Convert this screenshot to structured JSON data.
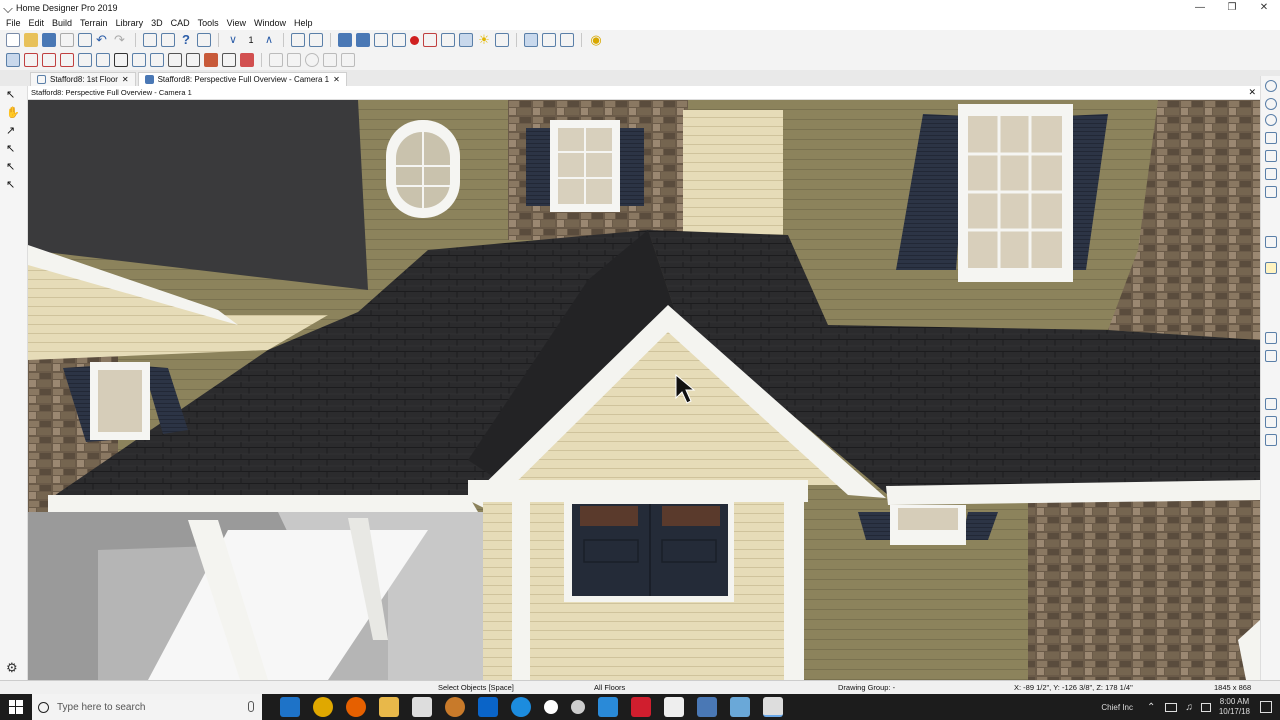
{
  "window": {
    "title": "Home Designer Pro 2019",
    "controls": {
      "minimize": "—",
      "restore": "❐",
      "close": "✕"
    }
  },
  "menu": [
    "File",
    "Edit",
    "Build",
    "Terrain",
    "Library",
    "3D",
    "CAD",
    "Tools",
    "View",
    "Window",
    "Help"
  ],
  "toolbar": {
    "floor_number": "1"
  },
  "tabs": [
    {
      "label": "Stafford8: 1st Floor",
      "close": "✕"
    },
    {
      "label": "Stafford8: Perspective Full Overview - Camera 1",
      "close": "✕"
    }
  ],
  "view": {
    "header": "Stafford8: Perspective Full Overview - Camera 1",
    "close": "✕"
  },
  "status": {
    "mode": "Select Objects [Space]",
    "floors": "All Floors",
    "drawing_group": "Drawing Group: -",
    "coords": "X: -89 1/2\", Y: -126 3/8\", Z: 178 1/4\"",
    "size": "1845 x 868"
  },
  "taskbar": {
    "search_placeholder": "Type here to search",
    "tray_label": "Chief Inc",
    "time": "8:00 AM",
    "date": "10/17/18"
  },
  "icons": {
    "start": "windows-logo-icon",
    "search": "search-circle-icon",
    "mic": "microphone-icon",
    "cursor": "arrow-cursor-icon",
    "settings": "gear-icon"
  },
  "colors": {
    "roof": "#2a2a2c",
    "siding_olive": "#8c835c",
    "siding_cream": "#e6dcb8",
    "trim": "#f4f4f0",
    "shutters": "#2c3445",
    "door": "#242b38",
    "stone": "#6b5b49",
    "taskbar": "#1c1c1c"
  }
}
